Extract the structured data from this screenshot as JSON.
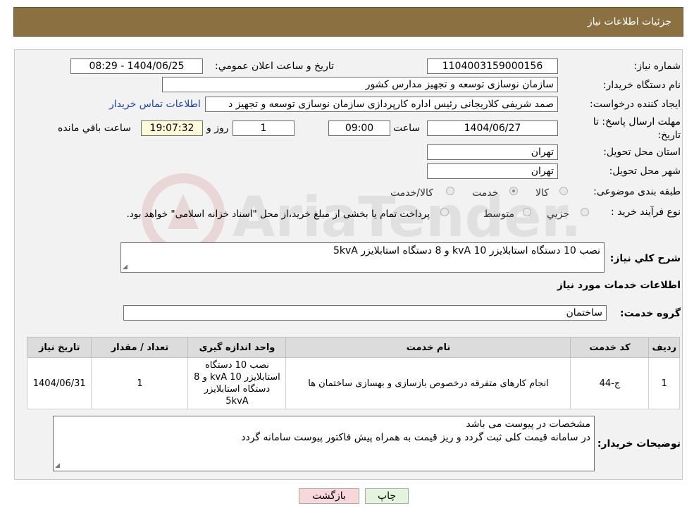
{
  "header": {
    "title": "جزئیات اطلاعات نیاز"
  },
  "form": {
    "need_number_label": "شماره نیاز:",
    "need_number": "1104003159000156",
    "announce_label": "تاریخ و ساعت اعلان عمومي:",
    "announce_value": "1404/06/25 - 08:29",
    "buyer_org_label": "نام دستگاه خريدار:",
    "buyer_org": "سازمان نوسازی  توسعه و تجهيز مدارس کشور",
    "requester_label": "ايجاد کننده درخواست:",
    "requester": "صمد شريفی کلاريجانی رئيس اداره کارپردازی سازمان نوسازی  توسعه و تجهيز د",
    "contact_link": "اطلاعات تماس خريدار",
    "deadline_label_1": "مهلت ارسال پاسخ: تا",
    "deadline_label_2": "تاريخ:",
    "deadline_date": "1404/06/27",
    "time_label": "ساعت",
    "deadline_time": "09:00",
    "days_value": "1",
    "days_label": "روز و",
    "remaining_time": "19:07:32",
    "remaining_label": "ساعت باقي مانده",
    "province_label": "استان محل تحويل:",
    "province": "تهران",
    "city_label": "شهر محل تحويل:",
    "city": "تهران",
    "category_label": "طبقه بندی موضوعی:",
    "category_options": [
      "کالا",
      "خدمت",
      "کالا/خدمت"
    ],
    "category_selected": 1,
    "purchase_type_label": "نوع فرآيند خريد :",
    "purchase_options": [
      "جزيي",
      "متوسط"
    ],
    "purchase_note": "پرداخت تمام يا بخشی از مبلغ خريد،از محل \"اسناد خزانه اسلامی\" خواهد بود.",
    "summary_label": "شرح کلي نياز:",
    "summary": "نصب 10 دستگاه استابلايزر 10 kvA   و 8 دستگاه استابلايزر 5kvA"
  },
  "services": {
    "section_title": "اطلاعات خدمات مورد نياز",
    "group_label": "گروه خدمت:",
    "group_value": "ساختمان",
    "columns": [
      "رديف",
      "کد خدمت",
      "نام خدمت",
      "واحد اندازه گيری",
      "تعداد / مقدار",
      "تاريخ نياز"
    ],
    "rows": [
      {
        "index": "1",
        "code": "ج-44",
        "name": "انجام کارهای متفرقه درخصوص بازسازی و بهسازی ساختمان ها",
        "unit": "نصب 10 دستگاه استابلايزر 10 kvA و 8 دستگاه استابلايزر 5kvA",
        "qty": "1",
        "date": "1404/06/31"
      }
    ]
  },
  "buyer_notes": {
    "label": "توضيحات خريدار:",
    "line1": "مشخصات در پيوست می باشد",
    "line2": "در سامانه قيمت کلی ثبت گردد و ريز قيمت به همراه پيش فاکتور پيوست سامانه گردد"
  },
  "buttons": {
    "print": "چاپ",
    "back": "بازگشت"
  },
  "watermark_text": "AriaTender.neT",
  "colors": {
    "header_bg": "#8b7142",
    "link": "#1a3ea8",
    "back_button": "#f8d7da",
    "print_button": "#e2f5dc"
  }
}
